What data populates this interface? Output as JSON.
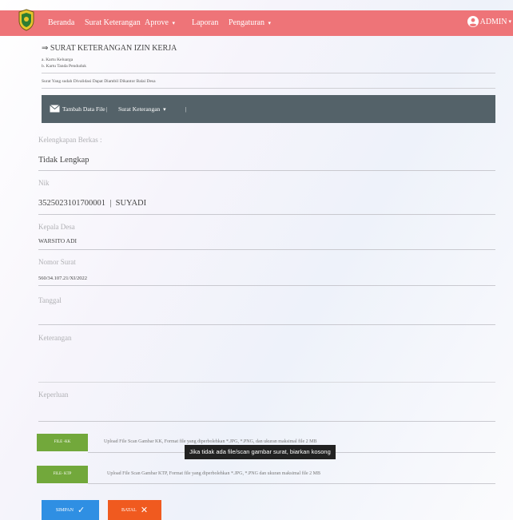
{
  "navbar": {
    "items": [
      {
        "label": "Beranda"
      },
      {
        "label": "Surat Keterangan"
      },
      {
        "label": "Aprove",
        "caret": "▾"
      },
      {
        "label": "Laporan"
      },
      {
        "label": "Pengaturan",
        "caret": "▾"
      }
    ],
    "user": "ADMIN",
    "accent": "#ee7478"
  },
  "header": {
    "title": "⇒ SURAT KETERANGAN IZIN KERJA",
    "requirements": [
      "a. Kartu Keluarga",
      "b. Kartu Tanda Penduduk"
    ],
    "note": "Surat Yang sudah Divalidasi Dapat Diambil Dikantor Balai Desa"
  },
  "toolbar": {
    "add_file": "Tambah Data File",
    "letter_menu": "Surat Keterangan",
    "sep": "|",
    "caret": "▾"
  },
  "form": {
    "kelengkapan_label": "Kelengkapan Berkas :",
    "kelengkapan_value": "Tidak Lengkap",
    "nik_label": "Nik",
    "nik_value": "3525023101700001  |  SUYADI",
    "kepala_label": "Kepala Desa",
    "kepala_value": "WARSITO ADI",
    "nomor_label": "Nomor Surat",
    "nomor_value": "560/34.107.21/XI/2022",
    "tanggal_label": "Tanggal",
    "keterangan_label": "Keterangan",
    "keperluan_label": "Keperluan"
  },
  "files": [
    {
      "button": "FILE -KK",
      "desc": "Upload File Scan Gambar KK, Format file yang diperbolehkan *.JPG, *.PNG, dan ukuran maksimal file 2 MB"
    },
    {
      "button": "FILE- KTP",
      "desc": "Upload File Scan Gambar KTP, Format file yang diperbolehkan *.JPG, *.PNG  dan ukuran maksimal file 2 MB"
    }
  ],
  "tooltip": "Jika tidak ada file/scan gambar surat, biarkan kosong",
  "actions": {
    "save": "SIMPAN",
    "cancel": "BATAL"
  }
}
